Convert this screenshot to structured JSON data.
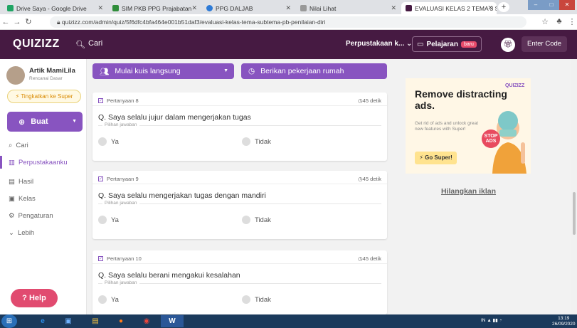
{
  "browser": {
    "tabs": [
      {
        "label": "Drive Saya - Google Drive"
      },
      {
        "label": "SIM PKB PPG Prajabatan"
      },
      {
        "label": "PPG DALJAB"
      },
      {
        "label": "Nilai Lihat"
      },
      {
        "label": "EVALUASI KELAS 2 TEMA 3 SUE"
      }
    ],
    "url": "quizizz.com/admin/quiz/5f6dfc4bfa464e001b51daf3/evaluasi-kelas-tema-subtema-pb-penilaian-diri"
  },
  "header": {
    "logo": "QUIZIZZ",
    "search": "Cari",
    "library": "Perpustakaan k...",
    "lessons": "Pelajaran",
    "lessons_badge": "baru",
    "enter_code": "Enter Code"
  },
  "sidebar": {
    "user_name": "Artik MamiLila",
    "user_role": "Rencanai Dasar",
    "upgrade": "Tingkatkan ke Super",
    "create": "Buat",
    "items": [
      {
        "label": "Cari",
        "icon": "search-icon"
      },
      {
        "label": "Perpustakaanku",
        "icon": "library-icon",
        "active": true
      },
      {
        "label": "Hasil",
        "icon": "chart-icon"
      },
      {
        "label": "Kelas",
        "icon": "class-icon"
      },
      {
        "label": "Pengaturan",
        "icon": "gear-icon"
      },
      {
        "label": "Lebih",
        "icon": "chevron-down-icon"
      }
    ],
    "help": "Help"
  },
  "actions": {
    "start_quiz": "Mulai kuis langsung",
    "homework": "Berikan pekerjaan rumah"
  },
  "questions": [
    {
      "number": "Pertanyaan 8",
      "time": "45 detik",
      "text": "Q. Saya selalu jujur dalam mengerjakan tugas",
      "choices_label": "Pilihan jawaban",
      "options": [
        "Ya",
        "Tidak"
      ]
    },
    {
      "number": "Pertanyaan 9",
      "time": "45 detik",
      "text": "Q. Saya selalu mengerjakan tugas dengan mandiri",
      "choices_label": "Pilihan jawaban",
      "options": [
        "Ya",
        "Tidak"
      ]
    },
    {
      "number": "Pertanyaan 10",
      "time": "45 detik",
      "text": "Q. Saya selalu berani mengakui kesalahan",
      "choices_label": "Pilihan jawaban",
      "options": [
        "Ya",
        "Tidak"
      ]
    }
  ],
  "ad": {
    "brand": "QUIZIZZ",
    "title": "Remove distracting ads.",
    "sub": "Get rid of ads and unlock great new features with Super!",
    "button": "Go Super!",
    "stop": "STOP ADS",
    "hide": "Hilangkan iklan"
  },
  "taskbar": {
    "tray": "IN",
    "time": "13:19",
    "date": "26/09/2020"
  },
  "colors": {
    "header": "#461a42",
    "accent": "#8854c0",
    "help": "#e14b70"
  }
}
